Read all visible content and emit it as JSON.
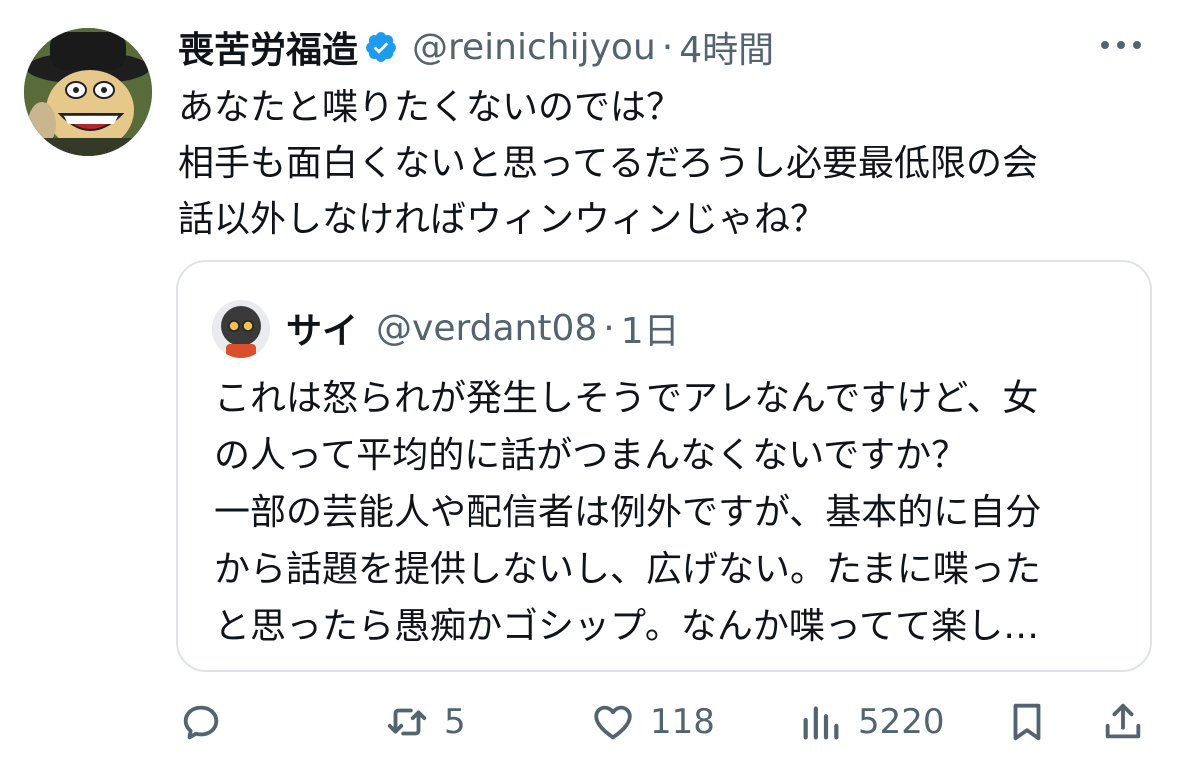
{
  "tweet": {
    "author_name": "喪苦労福造",
    "handle": "@reinichijyou",
    "separator": "·",
    "time": "4時間",
    "text_lines": [
      "あなたと喋りたくないのでは？",
      "相手も面白くないと思ってるだろうし必要最低限の会",
      "話以外しなければウィンウィンじゃね？"
    ]
  },
  "quote": {
    "author_name": "サイ",
    "handle": "@verdant08",
    "separator": "·",
    "time": "1日",
    "text_lines": [
      "これは怒られが発生しそうでアレなんですけど、女",
      "の人って平均的に話がつまんなくないですか？",
      "一部の芸能人や配信者は例外ですが、基本的に自分",
      "から話題を提供しないし、広げない。たまに喋った",
      "と思ったら愚痴かゴシップ。なんか喋ってて楽し…"
    ]
  },
  "actions": {
    "reply_count": "",
    "retweet_count": "5",
    "like_count": "118",
    "views_count": "5220"
  },
  "colors": {
    "text": "#0f1419",
    "secondary": "#536471",
    "verified": "#1d9bf0",
    "border": "#dfe3e7"
  },
  "icons": [
    "verified-badge-icon",
    "more-icon",
    "reply-icon",
    "retweet-icon",
    "like-icon",
    "views-icon",
    "bookmark-icon",
    "share-icon"
  ]
}
